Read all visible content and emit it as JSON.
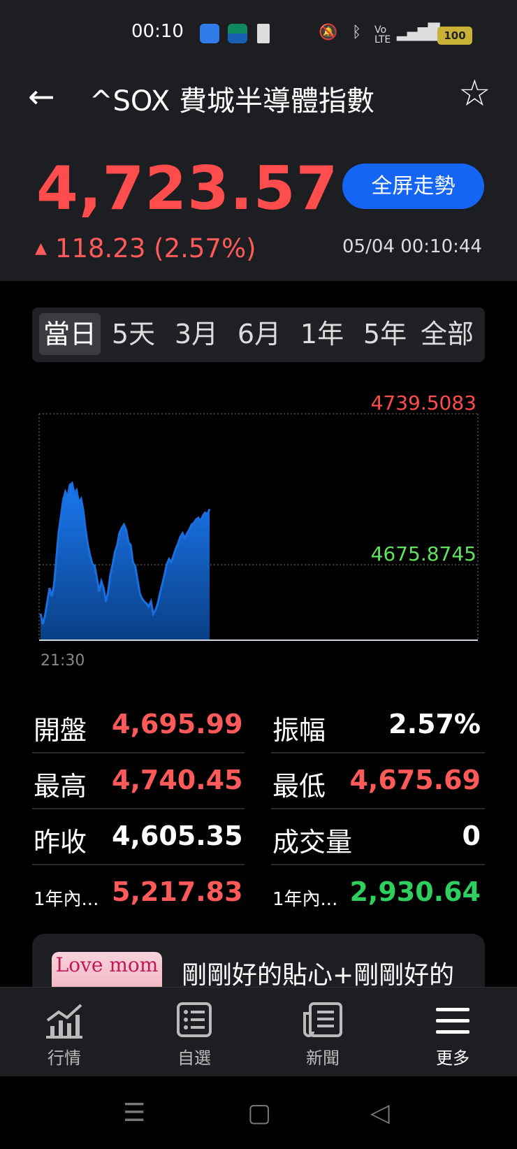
{
  "status_bar": {
    "time": "00:10",
    "battery": "100",
    "icons": [
      "android-app-icon",
      "familymart-app-icon",
      "door-app-icon",
      "mute-icon",
      "bluetooth-icon",
      "volte-icon",
      "4g-signal-icon",
      "battery-icon"
    ]
  },
  "header": {
    "title": "^SOX 費城半導體指數",
    "price": "4,723.57",
    "change": "118.23 (2.57%)",
    "fullscreen_label": "全屏走勢",
    "timestamp": "05/04 00:10:44"
  },
  "range_tabs": [
    "當日",
    "5天",
    "3月",
    "6月",
    "1年",
    "5年",
    "全部"
  ],
  "active_tab": "當日",
  "chart_data": {
    "type": "area",
    "high_label": "4739.5083",
    "low_label": "4675.8745",
    "x_start_label": "21:30",
    "ylim": [
      4669.2,
      4739.5083
    ],
    "series_color": "#1a6fe0",
    "values": [
      4677.4,
      4674.2,
      4676.9,
      4681.2,
      4685.4,
      4682.8,
      4686.5,
      4694.5,
      4702.5,
      4707.3,
      4712.6,
      4715.3,
      4713.7,
      4717.4,
      4718.0,
      4714.8,
      4715.8,
      4712.1,
      4713.1,
      4709.4,
      4703.5,
      4698.7,
      4695.5,
      4692.9,
      4692.3,
      4688.5,
      4684.3,
      4687.5,
      4685.4,
      4681.1,
      4684.3,
      4689.6,
      4692.8,
      4696.6,
      4698.7,
      4702.4,
      4704.0,
      4705.1,
      4703.5,
      4699.7,
      4698.7,
      4693.4,
      4692.3,
      4688.1,
      4683.8,
      4682.2,
      4681.2,
      4680.6,
      4679.6,
      4681.2,
      4677.4,
      4678.5,
      4680.6,
      4683.8,
      4686.5,
      4689.6,
      4692.8,
      4694.4,
      4693.4,
      4695.5,
      4697.6,
      4699.2,
      4701.3,
      4702.4,
      4700.8,
      4702.4,
      4703.5,
      4705.1,
      4705.6,
      4706.7,
      4707.2,
      4706.2,
      4707.8,
      4708.8,
      4708.3,
      4709.9
    ]
  },
  "stats": {
    "left": [
      {
        "label": "開盤",
        "value": "4,695.99",
        "color": "red"
      },
      {
        "label": "最高",
        "value": "4,740.45",
        "color": "red"
      },
      {
        "label": "昨收",
        "value": "4,605.35",
        "color": "white"
      },
      {
        "label": "1年內...",
        "value": "5,217.83",
        "color": "red",
        "small": true
      }
    ],
    "right": [
      {
        "label": "振幅",
        "value": "2.57%",
        "color": "white"
      },
      {
        "label": "最低",
        "value": "4,675.69",
        "color": "red"
      },
      {
        "label": "成交量",
        "value": "0",
        "color": "white"
      },
      {
        "label": "1年內...",
        "value": "2,930.64",
        "color": "green",
        "small": true
      }
    ]
  },
  "ad": {
    "image_text": "Love mom",
    "text": "剛剛好的貼心+剛剛好的"
  },
  "bottom_nav": [
    {
      "label": "行情",
      "icon": "chart-icon"
    },
    {
      "label": "自選",
      "icon": "watchlist-icon"
    },
    {
      "label": "新聞",
      "icon": "news-icon"
    },
    {
      "label": "更多",
      "icon": "menu-icon",
      "active": true
    }
  ]
}
